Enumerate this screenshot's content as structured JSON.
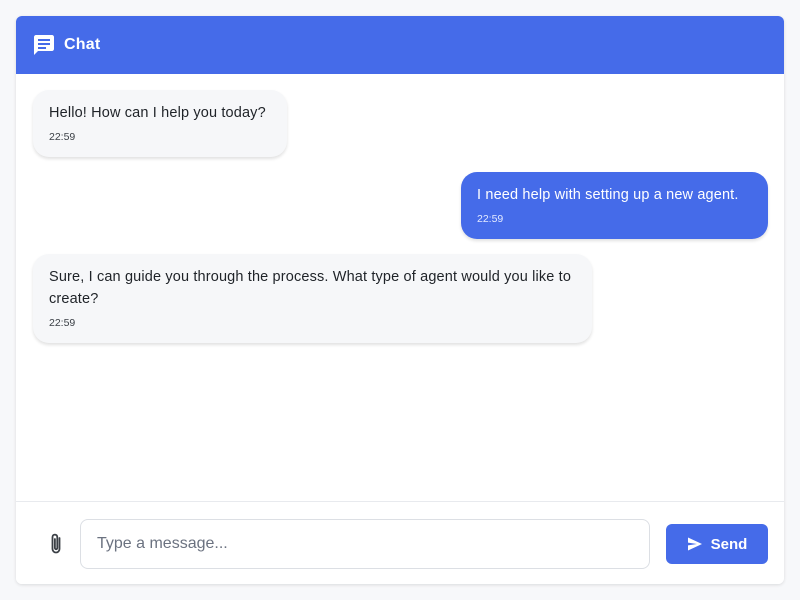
{
  "header": {
    "icon": "chat-icon",
    "title": "Chat",
    "accent_color": "#456be9"
  },
  "messages": [
    {
      "sender": "bot",
      "text": "Hello! How can I help you today?",
      "time": "22:59"
    },
    {
      "sender": "user",
      "text": "I need help with setting up a new agent.",
      "time": "22:59"
    },
    {
      "sender": "bot",
      "text": "Sure, I can guide you through the process. What type of agent would you like to create?",
      "time": "22:59"
    }
  ],
  "composer": {
    "attach_icon": "paperclip-icon",
    "placeholder": "Type a message...",
    "value": "",
    "send_icon": "send-icon",
    "send_label": "Send"
  }
}
